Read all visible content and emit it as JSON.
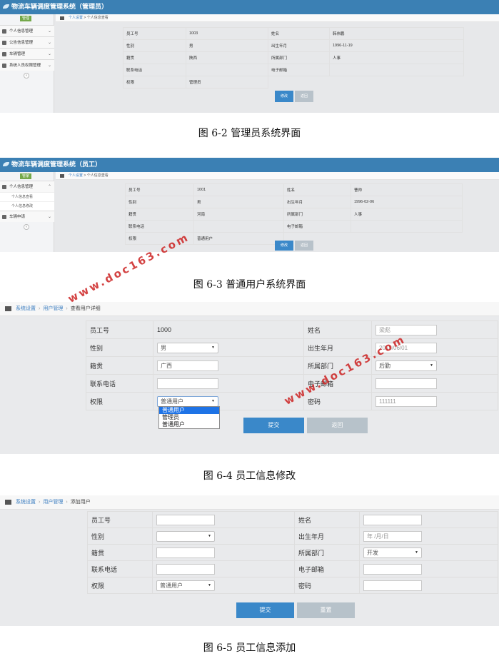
{
  "figures": [
    {
      "caption": "图 6-2 管理员系统界面",
      "app_title": "物流车辆调度管理系统（管理员）",
      "user_badge": "管理",
      "menu": [
        "个人信息管理",
        "公告信息管理",
        "车辆管理",
        "系统人员权限管理"
      ],
      "breadcrumb": [
        "个人设置",
        "个人信息查看"
      ],
      "rows": [
        [
          "员工号",
          "1003",
          "姓名",
          "韩伟鹏"
        ],
        [
          "性别",
          "男",
          "出生年月",
          "1996-11-19"
        ],
        [
          "籍贯",
          "陕西",
          "所属部门",
          "人事"
        ],
        [
          "联系电话",
          "",
          "电子邮箱",
          ""
        ],
        [
          "权限",
          "管理员",
          "",
          ""
        ]
      ],
      "buttons": [
        "修改",
        "返回"
      ]
    },
    {
      "caption": "图 6-3 普通用户系统界面",
      "app_title": "物流车辆调度管理系统（员工）",
      "user_badge": "管家",
      "menu": [
        "个人信息管理",
        "车辆申请"
      ],
      "submenu": [
        "个人信息查看",
        "个人信息修改"
      ],
      "breadcrumb": [
        "个人设置",
        "个人信息查看"
      ],
      "rows": [
        [
          "员工号",
          "1001",
          "姓名",
          "曹帅"
        ],
        [
          "性别",
          "男",
          "出生年月",
          "1996-02-06"
        ],
        [
          "籍贯",
          "河南",
          "所属部门",
          "人事"
        ],
        [
          "联系电话",
          "",
          "电子邮箱",
          ""
        ],
        [
          "权限",
          "普通用户",
          "",
          ""
        ]
      ],
      "buttons": [
        "修改",
        "返回"
      ]
    },
    {
      "caption": "图 6-4 员工信息修改",
      "breadcrumb": [
        "系统设置",
        "用户管理",
        "查看用户详细"
      ],
      "fields": {
        "emp_no_label": "员工号",
        "emp_no": "1000",
        "name_label": "姓名",
        "name": "梁彪",
        "gender_label": "性别",
        "gender": "男",
        "birth_label": "出生年月",
        "birth": "2018/06/01",
        "origin_label": "籍贯",
        "origin": "广西",
        "dept_label": "所属部门",
        "dept": "后勤",
        "phone_label": "联系电话",
        "phone": "",
        "email_label": "电子邮箱",
        "email": "",
        "role_label": "权限",
        "role": "普通用户",
        "password_label": "密码",
        "password": "111111"
      },
      "dropdown_options": [
        "普通用户",
        "管理员",
        "普通用户"
      ],
      "buttons": [
        "提交",
        "返回"
      ]
    },
    {
      "caption": "图 6-5 员工信息添加",
      "breadcrumb": [
        "系统设置",
        "用户管理",
        "添加用户"
      ],
      "fields": {
        "emp_no_label": "员工号",
        "name_label": "姓名",
        "gender_label": "性别",
        "birth_label": "出生年月",
        "birth_placeholder": "年 /月/日",
        "origin_label": "籍贯",
        "dept_label": "所属部门",
        "dept": "开发",
        "phone_label": "联系电话",
        "email_label": "电子邮箱",
        "role_label": "权限",
        "role": "普通用户",
        "password_label": "密码"
      },
      "buttons": [
        "提交",
        "重置"
      ]
    }
  ],
  "watermark": "www.doc163.com"
}
